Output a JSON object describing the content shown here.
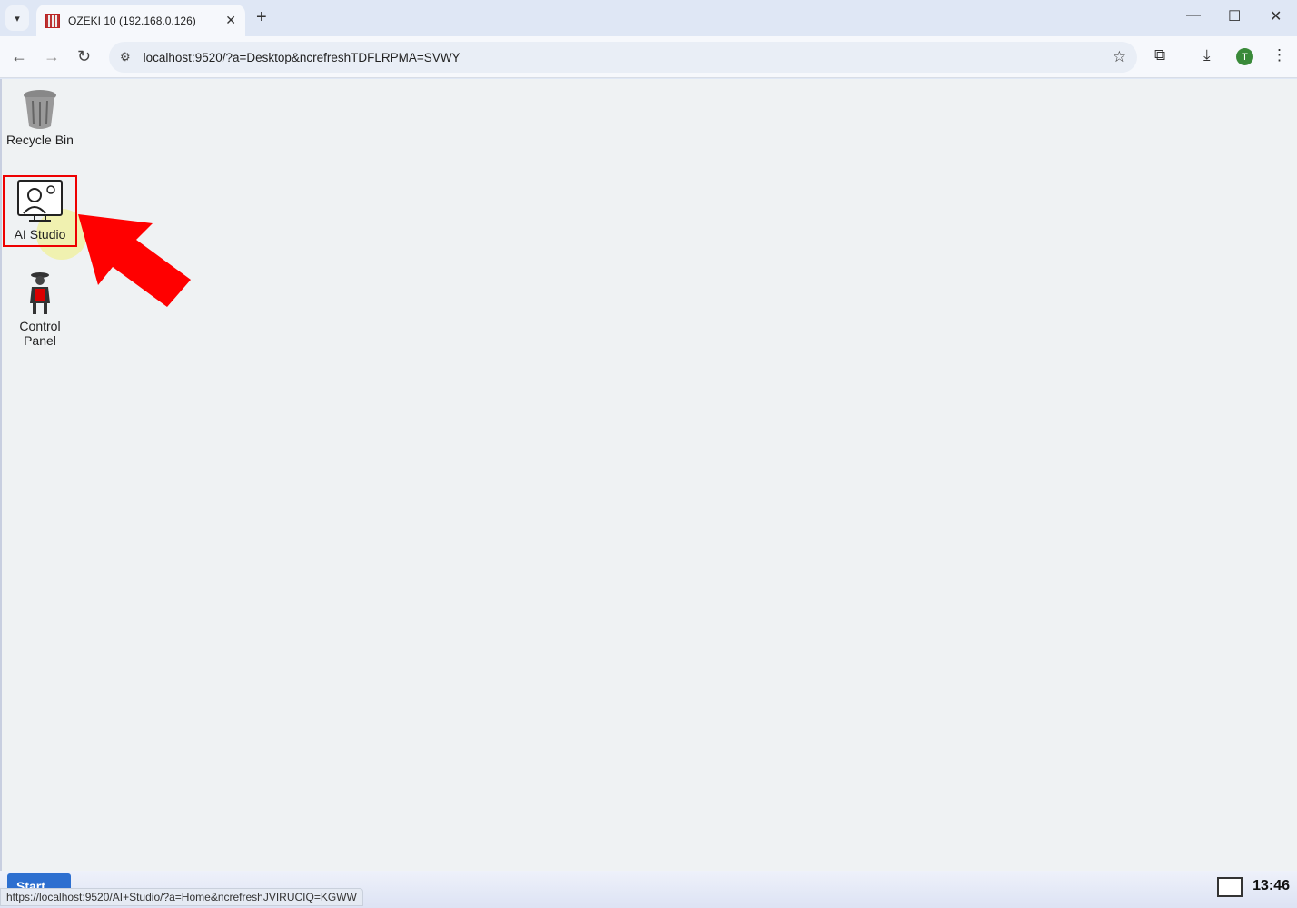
{
  "browser": {
    "tab_title": "OZEKI 10 (192.168.0.126)",
    "url": "localhost:9520/?a=Desktop&ncrefreshTDFLRPMA=SVWY",
    "profile_initial": "T",
    "status_url": "https://localhost:9520/AI+Studio/?a=Home&ncrefreshJVIRUCIQ=KGWW"
  },
  "desktop": {
    "icons": [
      {
        "label": "Recycle Bin",
        "icon": "recycle-bin-icon"
      },
      {
        "label": "AI Studio",
        "icon": "ai-studio-icon",
        "selected": true
      },
      {
        "label": "Control Panel",
        "icon": "control-panel-icon"
      }
    ],
    "annotation_color": "#ff0000"
  },
  "taskbar": {
    "start_label": "Start",
    "clock": "13:46"
  }
}
